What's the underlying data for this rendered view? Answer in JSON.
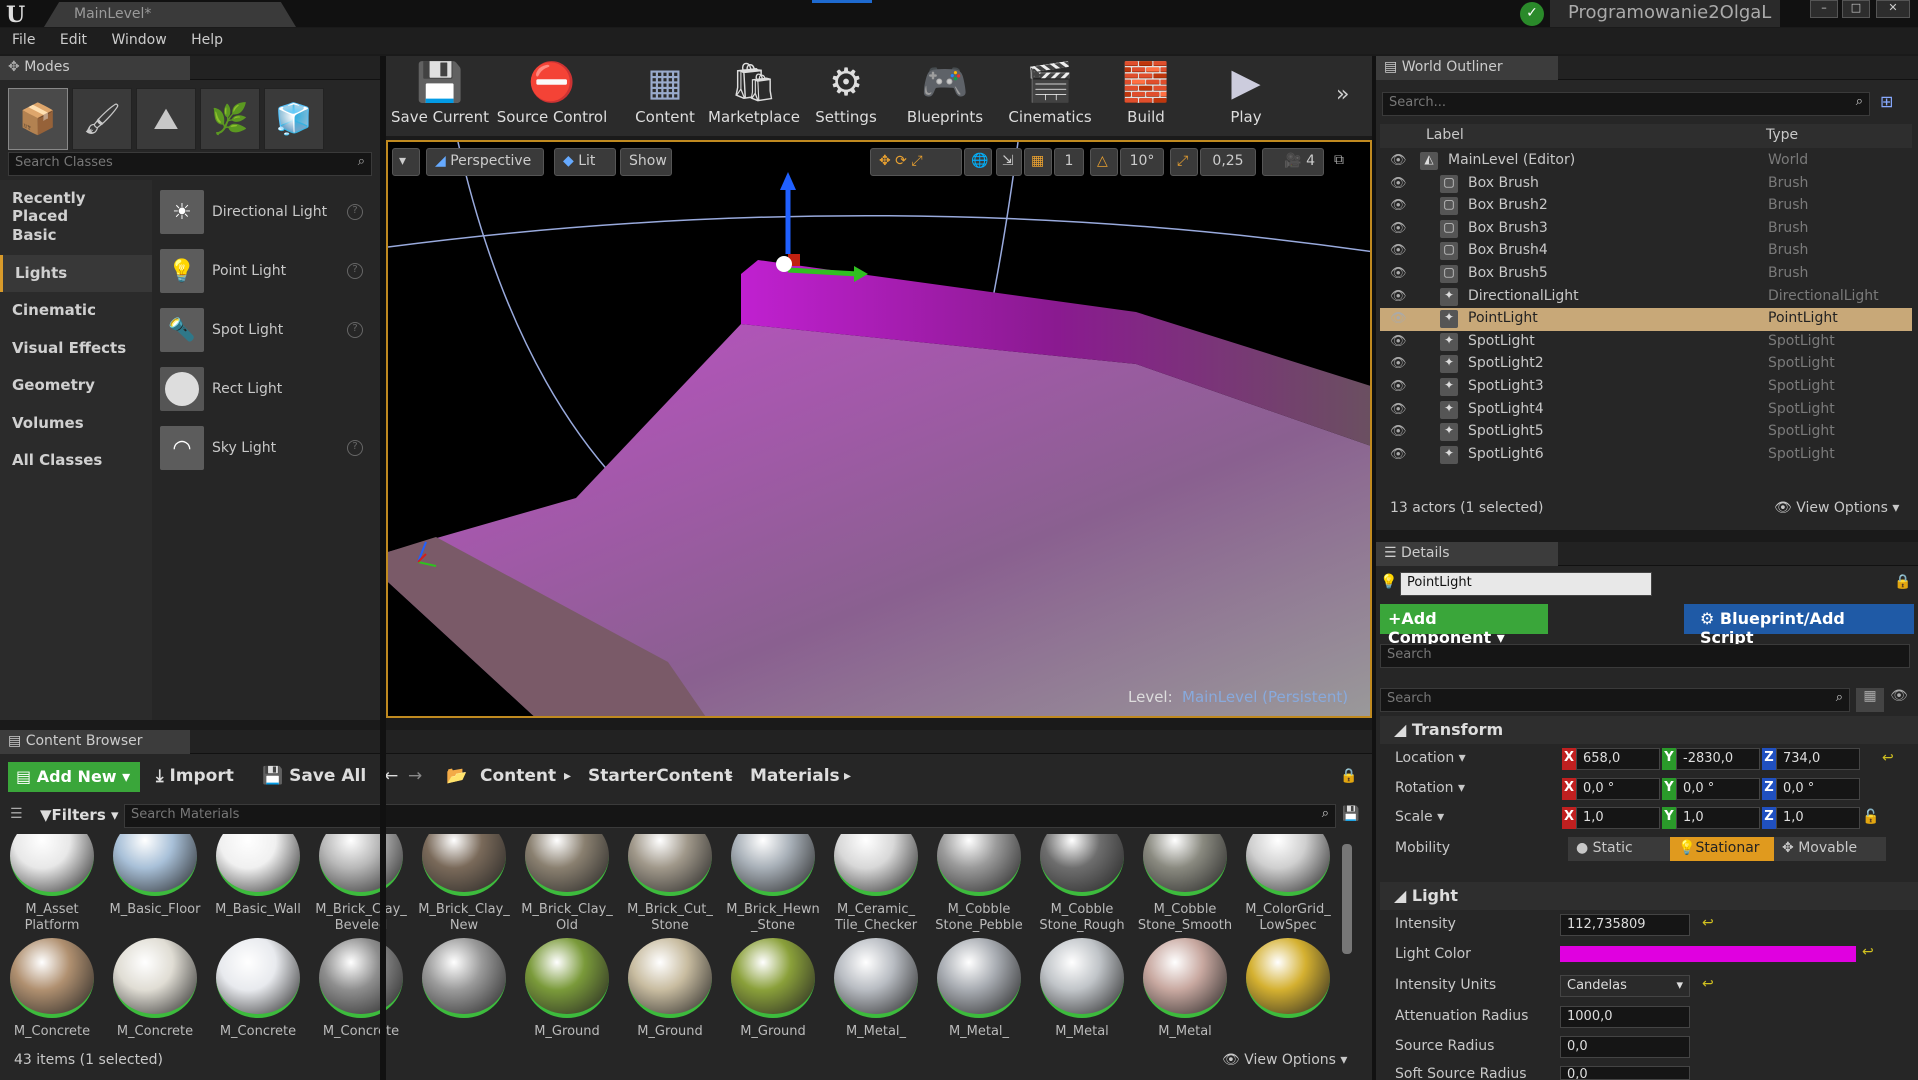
{
  "window": {
    "tab_title": "MainLevel*",
    "project_name": "Programowanie2OlgaL",
    "controls": [
      "–",
      "□",
      "✕"
    ]
  },
  "menu": [
    "File",
    "Edit",
    "Window",
    "Help"
  ],
  "modes": {
    "title": "Modes",
    "search_placeholder": "Search Classes",
    "categories": [
      "Recently Placed",
      "Basic",
      "Lights",
      "Cinematic",
      "Visual Effects",
      "Geometry",
      "Volumes",
      "All Classes"
    ],
    "selected_category": "Lights",
    "items": [
      "Directional Light",
      "Point Light",
      "Spot Light",
      "Rect Light",
      "Sky Light"
    ]
  },
  "toolbar": {
    "buttons": [
      "Save Current",
      "Source Control",
      "Content",
      "Marketplace",
      "Settings",
      "Blueprints",
      "Cinematics",
      "Build",
      "Play"
    ]
  },
  "viewport": {
    "perspective": "Perspective",
    "lit": "Lit",
    "show": "Show",
    "grid": "1",
    "angle": "10°",
    "scale": "0,25",
    "camera_speed": "4",
    "level_label": "Level:",
    "level_name": "MainLevel (Persistent)"
  },
  "outliner": {
    "title": "World Outliner",
    "search_placeholder": "Search...",
    "col_label": "Label",
    "col_type": "Type",
    "rows": [
      {
        "label": "MainLevel (Editor)",
        "type": "World"
      },
      {
        "label": "Box Brush",
        "type": "Brush"
      },
      {
        "label": "Box Brush2",
        "type": "Brush"
      },
      {
        "label": "Box Brush3",
        "type": "Brush"
      },
      {
        "label": "Box Brush4",
        "type": "Brush"
      },
      {
        "label": "Box Brush5",
        "type": "Brush"
      },
      {
        "label": "DirectionalLight",
        "type": "DirectionalLight"
      },
      {
        "label": "PointLight",
        "type": "PointLight"
      },
      {
        "label": "SpotLight",
        "type": "SpotLight"
      },
      {
        "label": "SpotLight2",
        "type": "SpotLight"
      },
      {
        "label": "SpotLight3",
        "type": "SpotLight"
      },
      {
        "label": "SpotLight4",
        "type": "SpotLight"
      },
      {
        "label": "SpotLight5",
        "type": "SpotLight"
      },
      {
        "label": "SpotLight6",
        "type": "SpotLight"
      }
    ],
    "status": "13 actors (1 selected)",
    "view_options": "View Options"
  },
  "details": {
    "title": "Details",
    "actor_name": "PointLight",
    "add_component": "Add Component",
    "blueprint": "Blueprint/Add Script",
    "search_placeholder": "Search",
    "transform": "Transform",
    "location_label": "Location",
    "location": [
      "658,0",
      "-2830,0",
      "734,0"
    ],
    "rotation_label": "Rotation",
    "rotation": [
      "0,0 °",
      "0,0 °",
      "0,0 °"
    ],
    "scale_label": "Scale",
    "scale": [
      "1,0",
      "1,0",
      "1,0"
    ],
    "mobility_label": "Mobility",
    "mobility_options": [
      "Static",
      "Stationar",
      "Movable"
    ],
    "light": "Light",
    "intensity_label": "Intensity",
    "intensity": "112,735809",
    "light_color_label": "Light Color",
    "light_color": "#e000e0",
    "intensity_units_label": "Intensity Units",
    "intensity_units": "Candelas",
    "attenuation_label": "Attenuation Radius",
    "attenuation": "1000,0",
    "source_radius_label": "Source Radius",
    "source_radius": "0,0",
    "soft_source_label": "Soft Source Radius",
    "soft_source": "0,0"
  },
  "content_browser": {
    "title": "Content Browser",
    "add_new": "Add New",
    "import": "Import",
    "save_all": "Save All",
    "path": [
      "Content",
      "StarterContent",
      "Materials"
    ],
    "filters": "Filters",
    "search_placeholder": "Search Materials",
    "row1": [
      {
        "name": "M_Asset Platform",
        "color": "#e8e8e8"
      },
      {
        "name": "M_Basic_Floor",
        "color": "#a8c0d8"
      },
      {
        "name": "M_Basic_Wall",
        "color": "#f0f0f0"
      },
      {
        "name": "M_Brick_Clay_ Beveled",
        "color": "#b8b8b8"
      },
      {
        "name": "M_Brick_Clay_ New",
        "color": "#7a6a5a"
      },
      {
        "name": "M_Brick_Clay_ Old",
        "color": "#8a8070"
      },
      {
        "name": "M_Brick_Cut_ Stone",
        "color": "#a0988a"
      },
      {
        "name": "M_Brick_Hewn _Stone",
        "color": "#a8b0b8"
      },
      {
        "name": "M_Ceramic_ Tile_Checker",
        "color": "#d8d8d8"
      },
      {
        "name": "M_Cobble Stone_Pebble",
        "color": "#9a9a9a"
      },
      {
        "name": "M_Cobble Stone_Rough",
        "color": "#6e6e6e"
      },
      {
        "name": "M_Cobble Stone_Smooth",
        "color": "#8a8a80"
      },
      {
        "name": "M_ColorGrid_ LowSpec",
        "color": "#cfcfcf"
      }
    ],
    "row2": [
      {
        "name": "M_Concrete",
        "color": "#b09070"
      },
      {
        "name": "M_Concrete",
        "color": "#e0ddd4"
      },
      {
        "name": "M_Concrete",
        "color": "#e8eaee"
      },
      {
        "name": "M_Concrete",
        "color": "#8e8e8e"
      },
      {
        "name": "",
        "color": "#9a9a9a"
      },
      {
        "name": "M_Ground",
        "color": "#7a9a3a"
      },
      {
        "name": "M_Ground",
        "color": "#c8bca0"
      },
      {
        "name": "M_Ground",
        "color": "#8aa03a"
      },
      {
        "name": "M_Metal_",
        "color": "#b8bcc2"
      },
      {
        "name": "M_Metal_",
        "color": "#a8acb2"
      },
      {
        "name": "M_Metal",
        "color": "#c0c4c8"
      },
      {
        "name": "M_Metal",
        "color": "#c8a8a0"
      },
      {
        "name": "",
        "color": "#d4b030"
      }
    ],
    "status": "43 items (1 selected)",
    "view_options": "View Options"
  }
}
